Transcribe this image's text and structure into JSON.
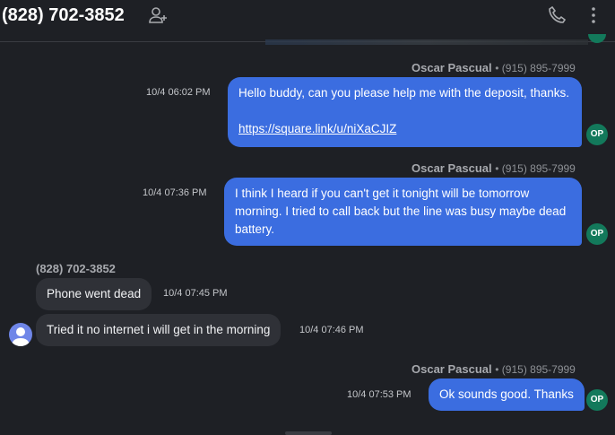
{
  "header": {
    "title": "(828) 702-3852",
    "add_contact_icon": "add-person-icon",
    "call_icon": "phone-icon",
    "menu_icon": "more-vertical-icon"
  },
  "messages": [
    {
      "sender": "Oscar Pascual",
      "sender_phone": "(915) 895-7999",
      "time": "10/4 06:02 PM",
      "text": "Hello buddy, can you please help me with the deposit, thanks.",
      "link": "https://square.link/u/niXaCJIZ",
      "avatar": "OP"
    },
    {
      "sender": "Oscar Pascual",
      "sender_phone": "(915) 895-7999",
      "time": "10/4 07:36 PM",
      "text": "I think I heard if you can't get it tonight will be tomorrow morning. I tried to call back but the line was busy maybe dead battery.",
      "avatar": "OP"
    },
    {
      "sender": "(828) 702-3852",
      "time": "10/4 07:45 PM",
      "text": "Phone went dead"
    },
    {
      "time": "10/4 07:46 PM",
      "text": "Tried it no internet i will get in the morning"
    },
    {
      "sender": "Oscar Pascual",
      "sender_phone": "(915) 895-7999",
      "time": "10/4 07:53 PM",
      "text": "Ok sounds good. Thanks",
      "avatar": "OP"
    }
  ],
  "colors": {
    "background": "#1e2025",
    "outgoing_bubble": "#3b6de0",
    "incoming_bubble": "#2f3137",
    "avatar_green": "#13795b",
    "user_avatar": "#6f86e8"
  }
}
